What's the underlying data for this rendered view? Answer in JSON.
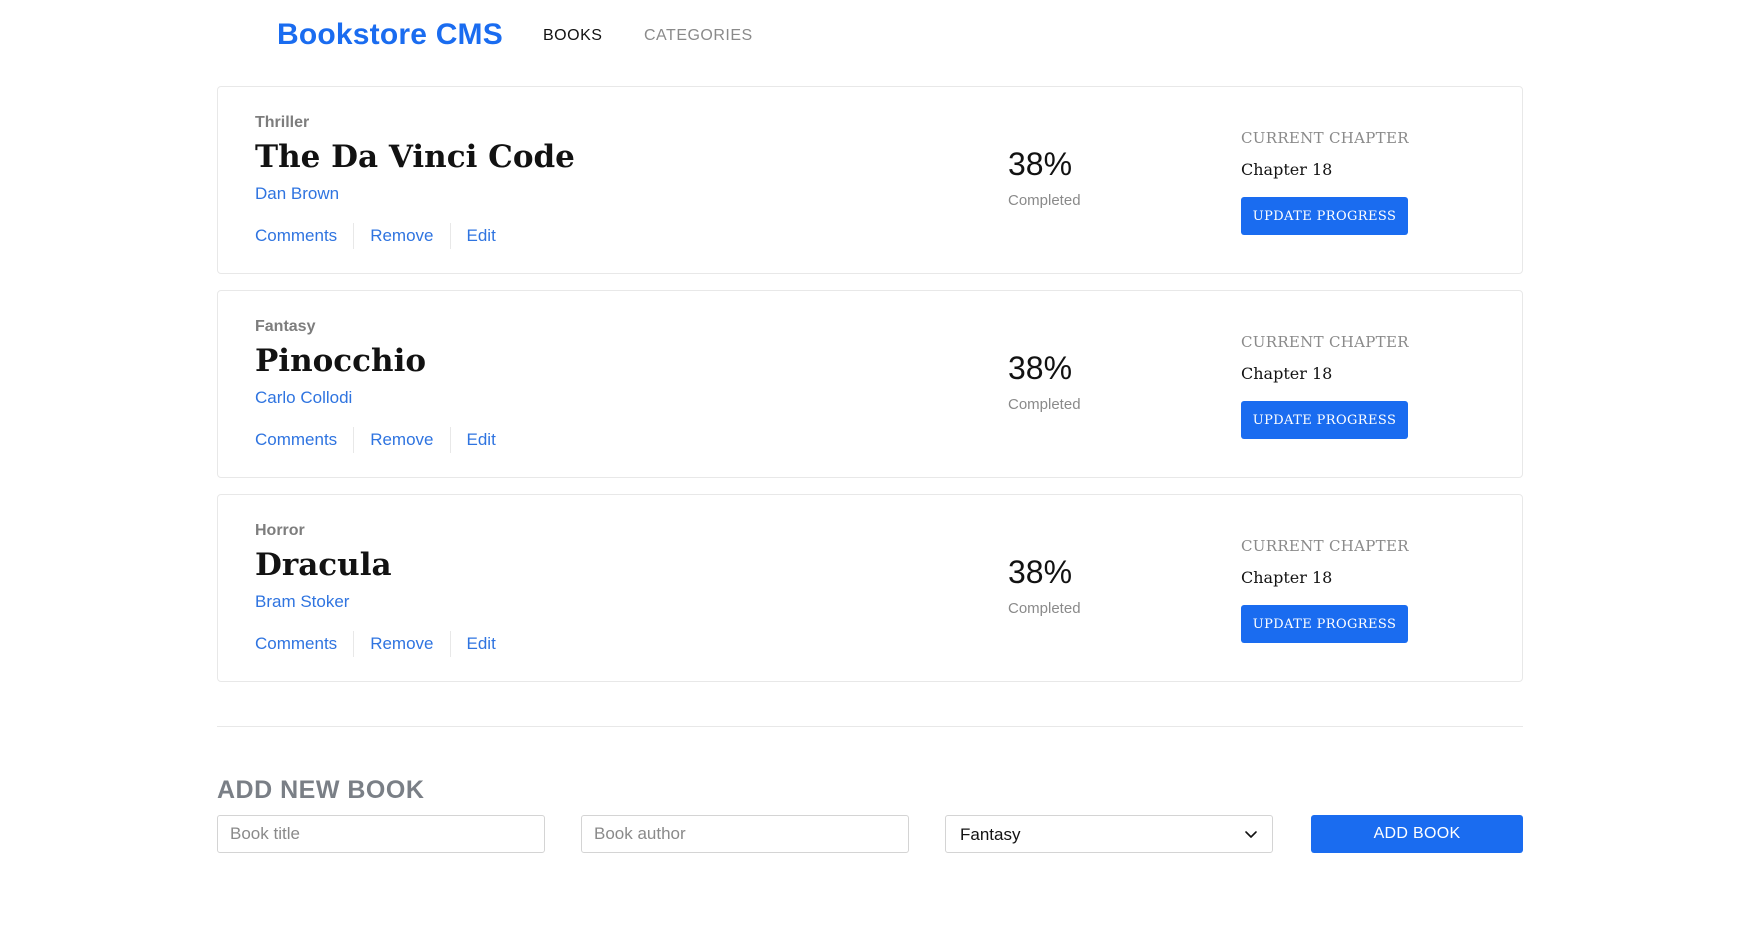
{
  "nav": {
    "brand": "Bookstore CMS",
    "links": [
      "BOOKS",
      "CATEGORIES"
    ],
    "active": "BOOKS"
  },
  "books": [
    {
      "genre": "Thriller",
      "title": "The Da Vinci Code",
      "author": "Dan Brown",
      "actions": [
        "Comments",
        "Remove",
        "Edit"
      ],
      "percent": "38%",
      "completed_label": "Completed",
      "chapter_label": "CURRENT CHAPTER",
      "chapter": "Chapter 18",
      "update_label": "UPDATE PROGRESS"
    },
    {
      "genre": "Fantasy",
      "title": "Pinocchio",
      "author": "Carlo Collodi",
      "actions": [
        "Comments",
        "Remove",
        "Edit"
      ],
      "percent": "38%",
      "completed_label": "Completed",
      "chapter_label": "CURRENT CHAPTER",
      "chapter": "Chapter 18",
      "update_label": "UPDATE PROGRESS"
    },
    {
      "genre": "Horror",
      "title": "Dracula",
      "author": "Bram Stoker",
      "actions": [
        "Comments",
        "Remove",
        "Edit"
      ],
      "percent": "38%",
      "completed_label": "Completed",
      "chapter_label": "CURRENT CHAPTER",
      "chapter": "Chapter 18",
      "update_label": "UPDATE PROGRESS"
    }
  ],
  "form": {
    "heading": "ADD NEW BOOK",
    "title_placeholder": "Book title",
    "title_value": "",
    "author_placeholder": "Book author",
    "author_value": "",
    "category_selected": "Fantasy",
    "submit_label": "ADD BOOK"
  },
  "colors": {
    "accent": "#1a6cf0",
    "muted": "#8a8a8a",
    "border": "#e8e8e8"
  },
  "icons": {
    "select_chevron": "chevron-down-icon"
  }
}
